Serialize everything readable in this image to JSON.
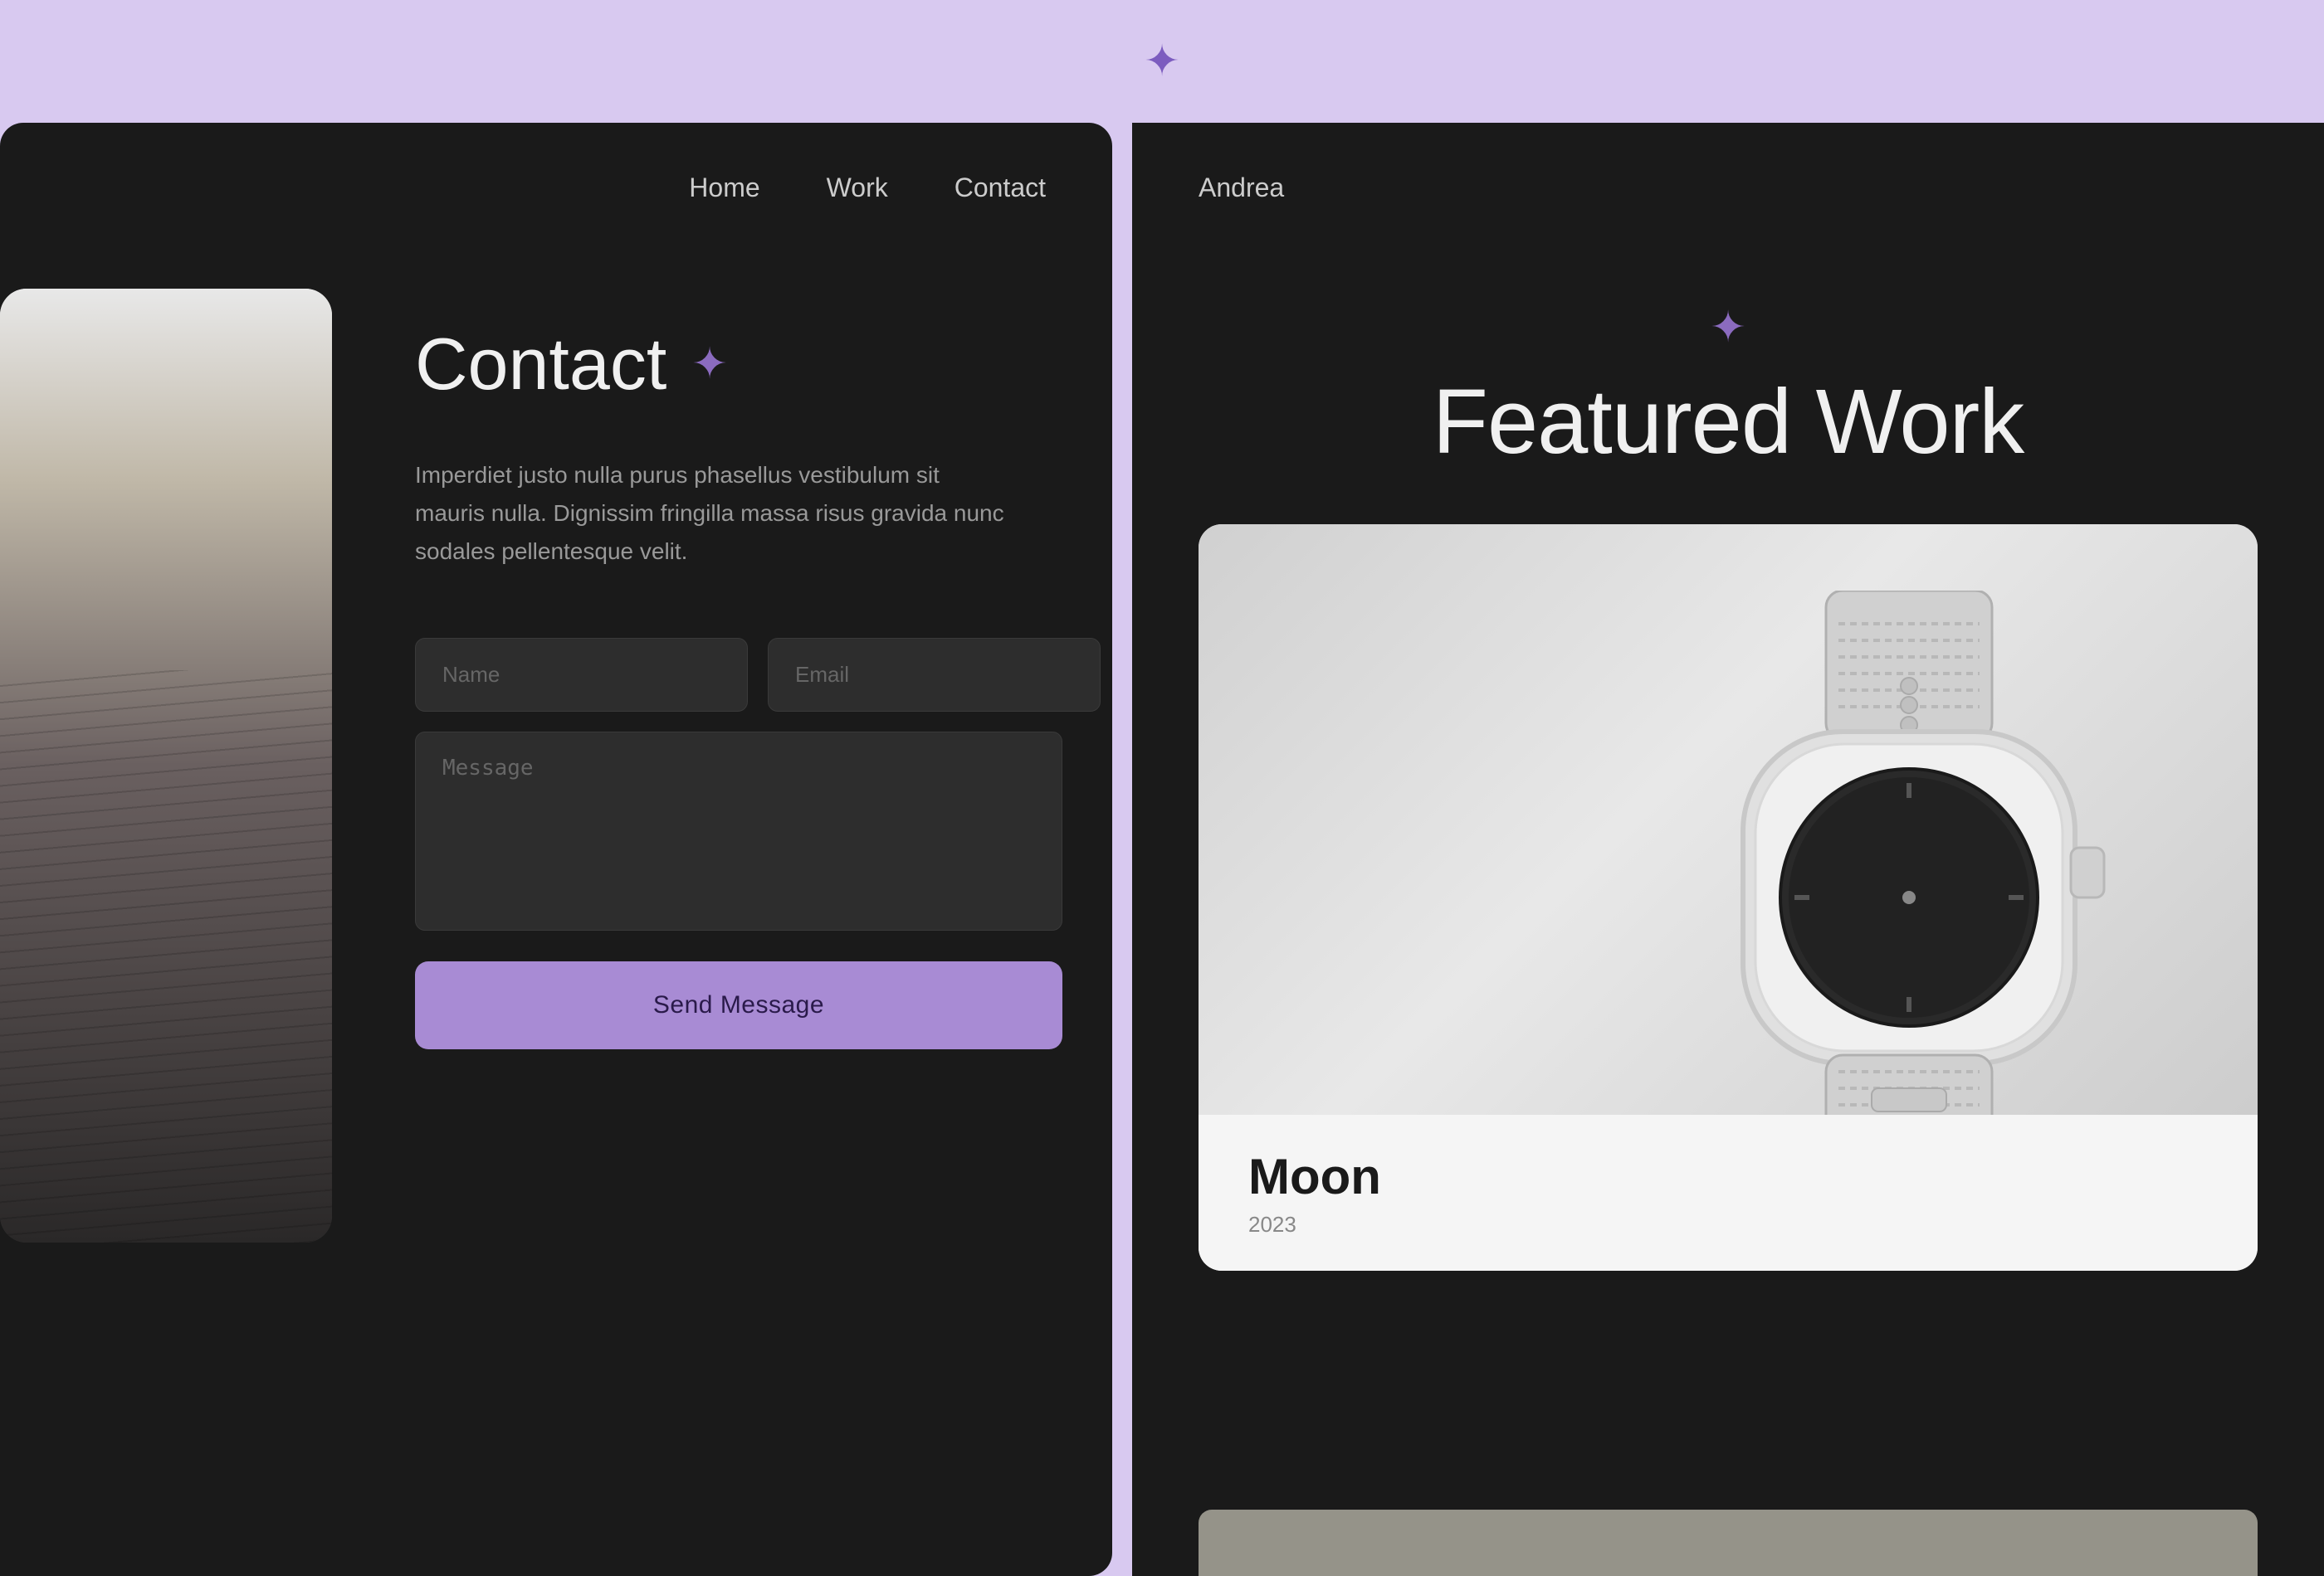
{
  "top_bar": {
    "star_symbol": "✦"
  },
  "left_panel": {
    "nav": {
      "home": "Home",
      "work": "Work",
      "contact": "Contact"
    },
    "contact": {
      "title": "Contact",
      "star": "✦",
      "description": "Imperdiet justo nulla purus phasellus vestibulum sit mauris nulla. Dignissim fringilla massa risus gravida nunc sodales pellentesque velit.",
      "form": {
        "name_placeholder": "Name",
        "email_placeholder": "Email",
        "message_placeholder": "Message",
        "send_button": "Send Message"
      }
    }
  },
  "right_panel": {
    "nav": {
      "logo": "Andrea"
    },
    "featured": {
      "star": "✦",
      "title": "Featured Work"
    },
    "card": {
      "name": "Moon",
      "year": "2023"
    }
  }
}
